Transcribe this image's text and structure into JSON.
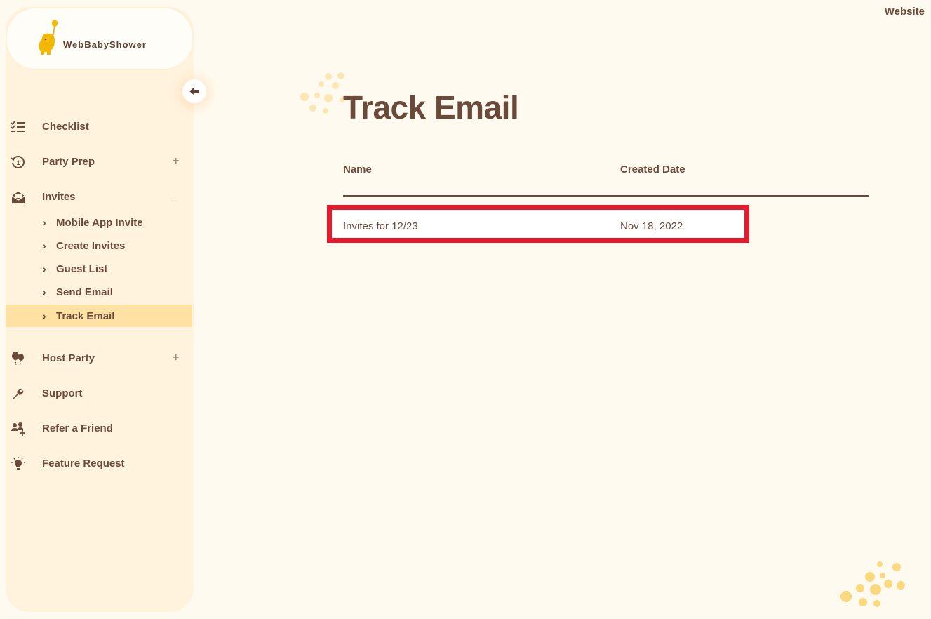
{
  "brand": {
    "name": "WebBabyShower"
  },
  "header": {
    "website_link": "Website"
  },
  "sidebar": {
    "collapse_icon": "arrow-left-icon",
    "items": [
      {
        "label": "Checklist",
        "icon": "checklist-icon"
      },
      {
        "label": "Party Prep",
        "icon": "history-clock-icon",
        "toggle": "+"
      },
      {
        "label": "Invites",
        "icon": "open-envelope-icon",
        "toggle": "–",
        "sub_items": [
          {
            "label": "Mobile App Invite"
          },
          {
            "label": "Create Invites"
          },
          {
            "label": "Guest List"
          },
          {
            "label": "Send Email"
          },
          {
            "label": "Track Email",
            "active": true
          }
        ]
      },
      {
        "label": "Host Party",
        "icon": "balloons-icon",
        "toggle": "+"
      },
      {
        "label": "Support",
        "icon": "wrench-icon"
      },
      {
        "label": "Refer a Friend",
        "icon": "user-plus-icon"
      },
      {
        "label": "Feature Request",
        "icon": "lightbulb-icon"
      }
    ]
  },
  "main": {
    "title": "Track Email",
    "table": {
      "columns": [
        "Name",
        "Created Date"
      ],
      "rows": [
        {
          "name": "Invites for 12/23",
          "created_date": "Nov 18, 2022"
        }
      ]
    }
  },
  "colors": {
    "background": "#fffaf0",
    "sidebar": "#fff3de",
    "text": "#6b4a3a",
    "active_item": "#ffe1a3",
    "highlight_box": "#e8192c",
    "accent_yellow": "#f5b800"
  }
}
